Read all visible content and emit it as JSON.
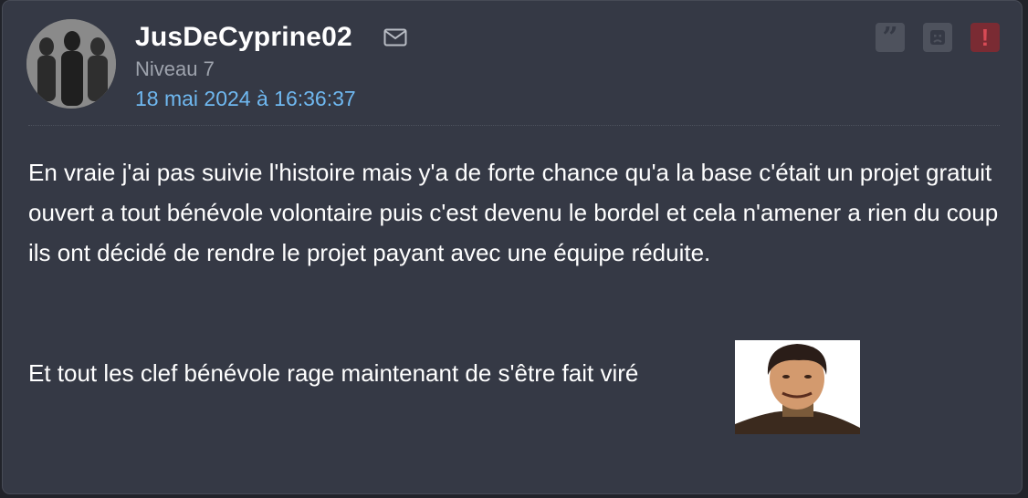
{
  "post": {
    "author": "JusDeCyprine02",
    "level": "Niveau 7",
    "date": "18 mai 2024 à 16:36:37",
    "paragraphs": [
      "En vraie j'ai pas suivie l'histoire mais y'a de forte chance qu'a la base c'était un projet gratuit ouvert a tout bénévole volontaire puis c'est devenu le bordel et cela n'amener a rien du coup ils ont décidé de rendre le projet payant avec une équipe réduite.",
      "Et tout les clef bénévole rage maintenant de s'être fait viré"
    ]
  },
  "icons": {
    "mail": "mail-icon",
    "quote": "quote-icon",
    "sad": "sad-face-icon",
    "report": "exclamation-icon"
  },
  "colors": {
    "background": "#353945",
    "date": "#6fb8f0",
    "report": "#7a2b33"
  }
}
